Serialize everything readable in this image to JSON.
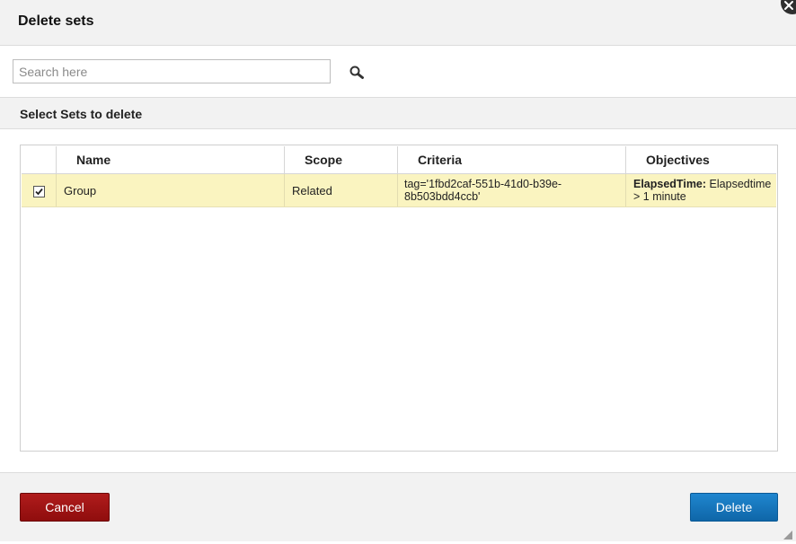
{
  "dialog": {
    "title": "Delete sets",
    "close_icon": "close-icon"
  },
  "search": {
    "value": "",
    "placeholder": "Search here",
    "icon": "search-icon"
  },
  "section": {
    "title": "Select Sets to delete"
  },
  "table": {
    "columns": [
      "",
      "Name",
      "Scope",
      "Criteria",
      "Objectives"
    ],
    "rows": [
      {
        "checked": true,
        "name": "Group",
        "scope": "Related",
        "criteria": "tag='1fbd2caf-551b-41d0-b39e-8b503bdd4ccb'",
        "objectives_label": "ElapsedTime:",
        "objectives_value": "Elapsedtime > 1 minute"
      }
    ]
  },
  "footer": {
    "cancel_label": "Cancel",
    "delete_label": "Delete"
  },
  "colors": {
    "selected_row": "#faf4c0",
    "cancel": "#a01515",
    "delete": "#1777bf"
  }
}
